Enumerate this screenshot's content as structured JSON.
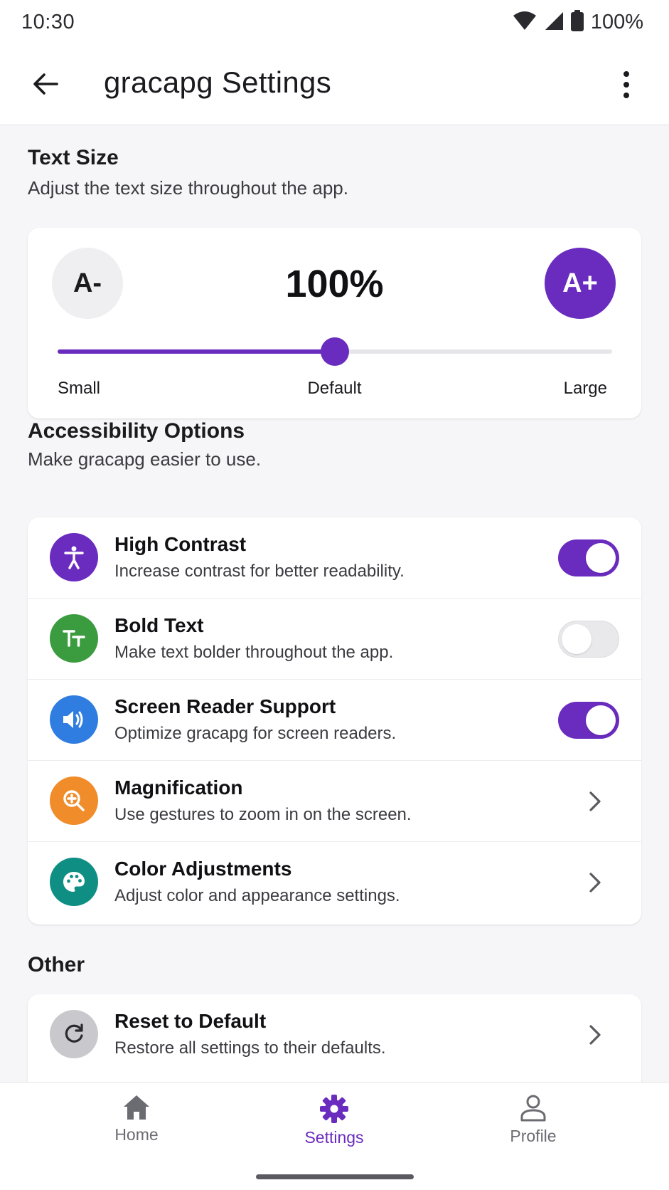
{
  "status": {
    "time": "10:30",
    "battery": "100%"
  },
  "app_bar": {
    "title": "gracapg Settings"
  },
  "text_size": {
    "title": "Text Size",
    "subtitle": "Adjust the text size throughout the app.",
    "decrease_label": "A-",
    "increase_label": "A+",
    "value_text": "100%",
    "slider_level_fraction": 0.5,
    "label_small": "Small",
    "label_default": "Default",
    "label_large": "Large"
  },
  "accessibility": {
    "title": "Accessibility Options",
    "subtitle": "Make gracapg easier to use.",
    "items": [
      {
        "title": "High Contrast",
        "desc": "Increase contrast for better readability.",
        "control": "toggle",
        "on": true,
        "icon": "accessibility-icon",
        "icon_color": "#6a2bbf"
      },
      {
        "title": "Bold Text",
        "desc": "Make text bolder throughout the app.",
        "control": "toggle",
        "on": false,
        "icon": "text-format-icon",
        "icon_color": "#3b9b3f"
      },
      {
        "title": "Screen Reader Support",
        "desc": "Optimize gracapg for screen readers.",
        "control": "toggle",
        "on": true,
        "icon": "speaker-icon",
        "icon_color": "#2f7de1"
      },
      {
        "title": "Magnification",
        "desc": "Use gestures to zoom in on the screen.",
        "control": "chevron",
        "icon": "zoom-in-icon",
        "icon_color": "#f08c2a"
      },
      {
        "title": "Color Adjustments",
        "desc": "Adjust color and appearance settings.",
        "control": "chevron",
        "icon": "palette-icon",
        "icon_color": "#0f8f84"
      }
    ]
  },
  "other": {
    "title": "Other",
    "items": [
      {
        "title": "Reset to Default",
        "desc": "Restore all settings to their defaults.",
        "control": "chevron",
        "icon": "reset-icon",
        "icon_color": "#c9c9cd"
      }
    ]
  },
  "nav": {
    "home": "Home",
    "settings": "Settings",
    "profile": "Profile",
    "active": "settings"
  },
  "colors": {
    "accent": "#6a2bbf"
  }
}
